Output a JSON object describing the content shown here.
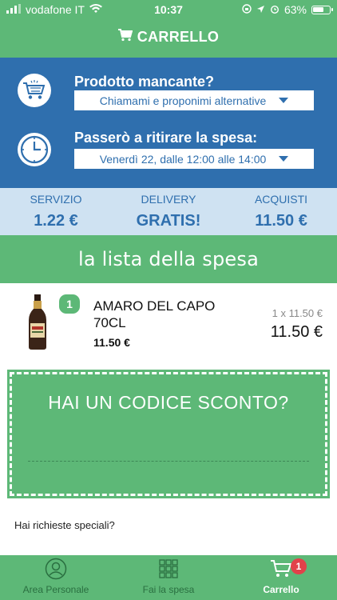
{
  "status_bar": {
    "carrier": "vodafone IT",
    "time": "10:37",
    "battery": "63%"
  },
  "header": {
    "title": "CARRELLO"
  },
  "missing_product": {
    "label": "Prodotto mancante?",
    "selected": "Chiamami e proponimi alternative"
  },
  "pickup": {
    "label": "Passerò a ritirare la spesa:",
    "selected": "Venerdì 22, dalle 12:00 alle 14:00"
  },
  "costs": [
    {
      "label": "SERVIZIO",
      "value": "1.22 €"
    },
    {
      "label": "DELIVERY",
      "value": "GRATIS!"
    },
    {
      "label": "ACQUISTI",
      "value": "11.50 €"
    }
  ],
  "list_title": "la lista della spesa",
  "cart_items": [
    {
      "quantity": "1",
      "name": "AMARO DEL CAPO 70CL",
      "price": "11.50 €",
      "unit_line": "1 x 11.50 €",
      "total": "11.50 €"
    }
  ],
  "coupon": {
    "title": "HAI UN CODICE SCONTO?"
  },
  "special_requests": "Hai richieste speciali?",
  "tabs": [
    {
      "label": "Area Personale",
      "icon": "person-icon"
    },
    {
      "label": "Fai la spesa",
      "icon": "grid-icon"
    },
    {
      "label": "Carrello",
      "icon": "cart-icon",
      "badge": "1",
      "active": true
    }
  ],
  "colors": {
    "green": "#5db877",
    "blue": "#2f6fae",
    "light_blue": "#cfe2f2",
    "badge_red": "#e2424a"
  }
}
